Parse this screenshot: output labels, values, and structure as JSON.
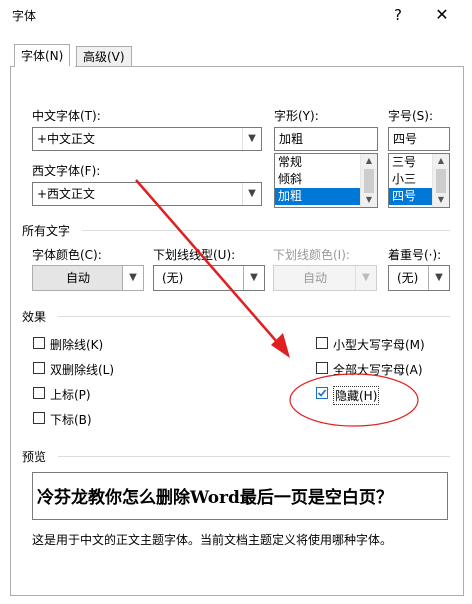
{
  "window": {
    "title": "字体",
    "help_label": "?",
    "close_label": "✕"
  },
  "tabs": [
    {
      "label": "字体(N)",
      "active": true
    },
    {
      "label": "高级(V)",
      "active": false
    }
  ],
  "font": {
    "chinese_label": "中文字体(T):",
    "chinese_value": "+中文正文",
    "western_label": "西文字体(F):",
    "western_value": "+西文正文",
    "style_label": "字形(Y):",
    "style_value": "加粗",
    "style_options": [
      "常规",
      "倾斜",
      "加粗"
    ],
    "style_selected": "加粗",
    "size_label": "字号(S):",
    "size_value": "四号",
    "size_options": [
      "三号",
      "小三",
      "四号"
    ],
    "size_selected": "四号"
  },
  "all_text": {
    "section_label": "所有文字",
    "font_color_label": "字体颜色(C):",
    "font_color_value": "自动",
    "underline_style_label": "下划线线型(U):",
    "underline_style_value": "(无)",
    "underline_color_label": "下划线颜色(I):",
    "underline_color_value": "自动",
    "emphasis_label": "着重号(·):",
    "emphasis_value": "(无)"
  },
  "effects": {
    "section_label": "效果",
    "strikethrough": {
      "label": "删除线(K)",
      "checked": false
    },
    "double_strikethrough": {
      "label": "双删除线(L)",
      "checked": false
    },
    "superscript": {
      "label": "上标(P)",
      "checked": false
    },
    "subscript": {
      "label": "下标(B)",
      "checked": false
    },
    "small_caps": {
      "label": "小型大写字母(M)",
      "checked": false
    },
    "all_caps": {
      "label": "全部大写字母(A)",
      "checked": false
    },
    "hidden": {
      "label": "隐藏(H)",
      "checked": true
    }
  },
  "preview": {
    "section_label": "预览",
    "text": "冷芬龙教你怎么删除Word最后一页是空白页？",
    "note": "这是用于中文的正文主题字体。当前文档主题定义将使用哪种字体。"
  },
  "colors": {
    "annotation_red": "#e02020",
    "selection_blue": "#0078d7",
    "check_blue": "#1a6fc9"
  }
}
